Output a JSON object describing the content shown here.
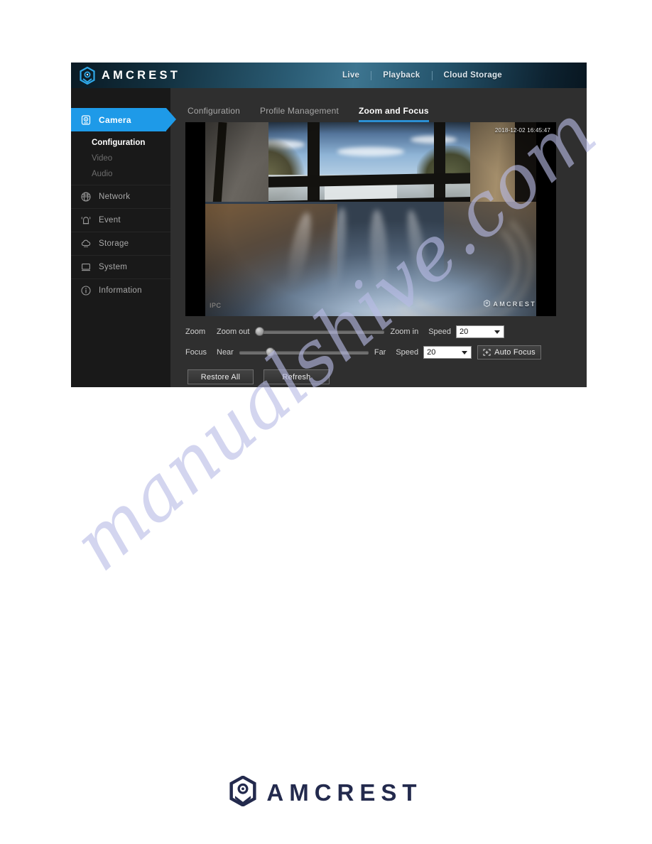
{
  "colors": {
    "accent_blue": "#1e9ae8",
    "tab_underline": "#2b8fd4",
    "sidebar_bg": "#191919",
    "content_bg": "#2f2f2f",
    "watermark": "#b9bce6"
  },
  "watermark": {
    "text": "manualshive.com"
  },
  "header": {
    "brand": "AMCREST",
    "logo_icon": "amcrest-hex-logo-icon",
    "nav": [
      {
        "label": "Live"
      },
      {
        "label": "Playback"
      },
      {
        "label": "Cloud Storage"
      }
    ]
  },
  "sidebar": {
    "items": [
      {
        "label": "Camera",
        "icon": "camera-icon",
        "active": true
      },
      {
        "label": "Network",
        "icon": "network-globe-icon",
        "active": false
      },
      {
        "label": "Event",
        "icon": "alarm-bell-icon",
        "active": false
      },
      {
        "label": "Storage",
        "icon": "cloud-icon",
        "active": false
      },
      {
        "label": "System",
        "icon": "monitor-icon",
        "active": false
      },
      {
        "label": "Information",
        "icon": "info-circle-icon",
        "active": false
      }
    ],
    "sub_items": [
      {
        "label": "Configuration",
        "active": true
      },
      {
        "label": "Video",
        "active": false
      },
      {
        "label": "Audio",
        "active": false
      }
    ]
  },
  "main": {
    "tabs": [
      {
        "label": "Configuration",
        "active": false
      },
      {
        "label": "Profile Management",
        "active": false
      },
      {
        "label": "Zoom and Focus",
        "active": true
      }
    ],
    "video": {
      "timestamp": "2018-12-02 16:45:47",
      "camera_name": "IPC",
      "brand_overlay": "AMCREST",
      "brand_overlay_icon": "amcrest-hex-logo-icon"
    },
    "controls": {
      "zoom": {
        "label": "Zoom",
        "min_label": "Zoom out",
        "max_label": "Zoom in",
        "value_percent": 0,
        "speed_label": "Speed",
        "speed_value": "20"
      },
      "focus": {
        "label": "Focus",
        "min_label": "Near",
        "max_label": "Far",
        "value_percent": 22,
        "speed_label": "Speed",
        "speed_value": "20",
        "auto_focus_label": "Auto Focus",
        "auto_focus_icon": "focus-frame-icon"
      },
      "buttons": [
        {
          "label": "Restore All"
        },
        {
          "label": "Refresh"
        }
      ]
    }
  },
  "footer": {
    "brand": "AMCREST",
    "logo_icon": "amcrest-hex-logo-icon"
  }
}
